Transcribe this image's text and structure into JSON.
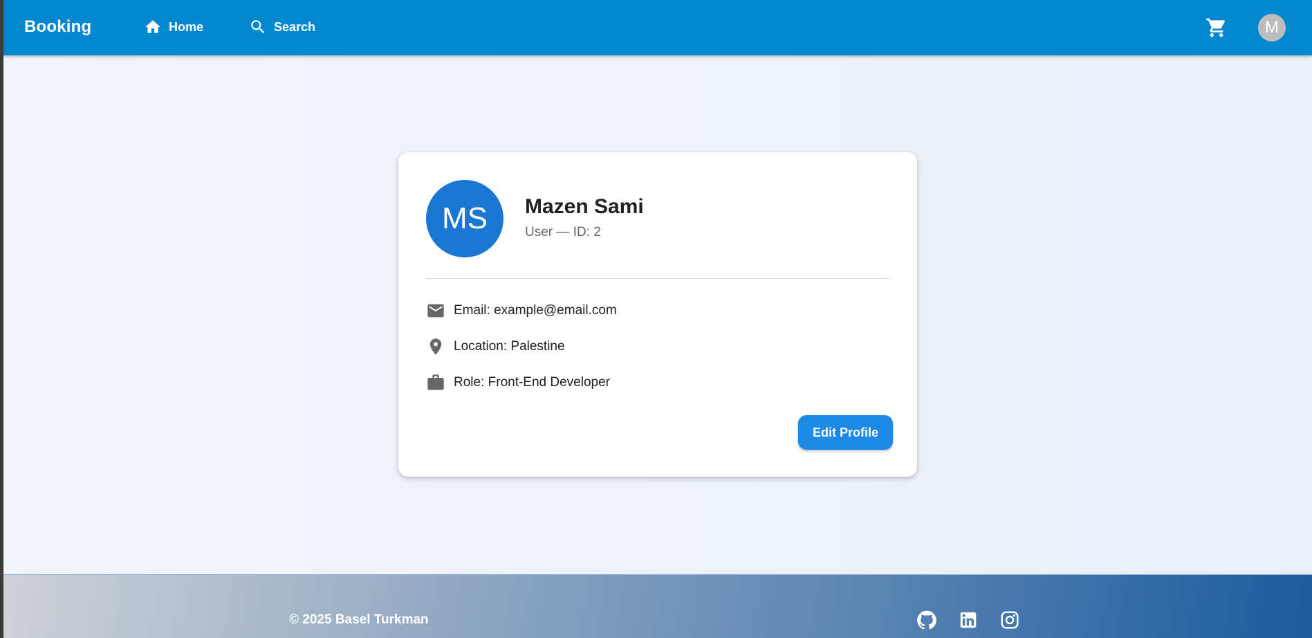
{
  "appbar": {
    "brand": "Booking",
    "nav": [
      {
        "label": "Home",
        "icon": "home-icon"
      },
      {
        "label": "Search",
        "icon": "search-icon"
      }
    ],
    "cart_icon": "cart-icon",
    "avatar_initial": "M",
    "background_color": "#0288d1"
  },
  "profile": {
    "initials": "MS",
    "name": "Mazen Sami",
    "subtitle": "User — ID: 2",
    "avatar_color": "#1976d2",
    "details": [
      {
        "icon": "email-icon",
        "text": "Email: example@email.com"
      },
      {
        "icon": "location-pin-icon",
        "text": "Location: Palestine"
      },
      {
        "icon": "briefcase-icon",
        "text": "Role: Front-End Developer"
      }
    ],
    "edit_label": "Edit Profile"
  },
  "footer": {
    "copyright": "© 2025 Basel Turkman",
    "social": [
      "github-icon",
      "linkedin-icon",
      "instagram-icon"
    ]
  }
}
